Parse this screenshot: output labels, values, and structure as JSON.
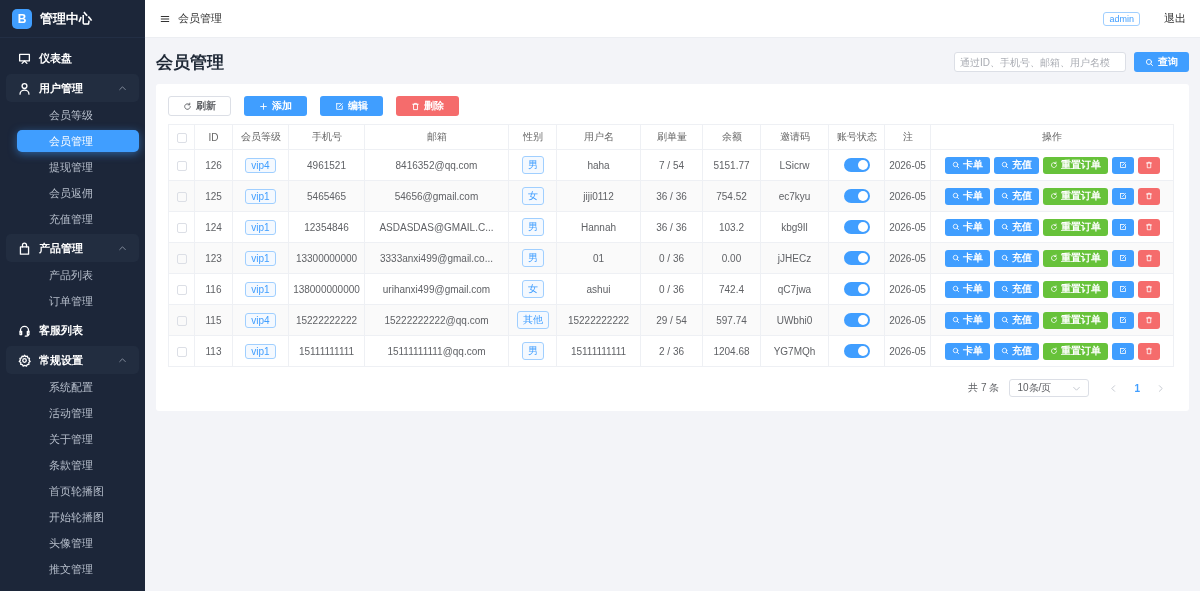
{
  "sidebar": {
    "brand": {
      "logo": "B",
      "title": "管理中心"
    },
    "items": [
      {
        "kind": "link",
        "label": "仪表盘"
      },
      {
        "kind": "group",
        "label": "用户管理",
        "expanded": true,
        "children": [
          {
            "label": "会员等级",
            "selected": false
          },
          {
            "label": "会员管理",
            "selected": true
          },
          {
            "label": "提现管理",
            "selected": false
          },
          {
            "label": "会员返佣",
            "selected": false
          },
          {
            "label": "充值管理",
            "selected": false
          }
        ]
      },
      {
        "kind": "group",
        "label": "产品管理",
        "expanded": true,
        "children": [
          {
            "label": "产品列表",
            "selected": false
          },
          {
            "label": "订单管理",
            "selected": false
          }
        ]
      },
      {
        "kind": "link",
        "label": "客服列表"
      },
      {
        "kind": "group",
        "label": "常规设置",
        "expanded": true,
        "children": [
          {
            "label": "系统配置",
            "selected": false
          },
          {
            "label": "活动管理",
            "selected": false
          },
          {
            "label": "关于管理",
            "selected": false
          },
          {
            "label": "条款管理",
            "selected": false
          },
          {
            "label": "首页轮播图",
            "selected": false
          },
          {
            "label": "开始轮播图",
            "selected": false
          },
          {
            "label": "头像管理",
            "selected": false
          },
          {
            "label": "推文管理",
            "selected": false
          }
        ]
      }
    ]
  },
  "topbar": {
    "breadcrumb": "会员管理",
    "user": "admin",
    "logout": "退出"
  },
  "page": {
    "title": "会员管理",
    "search": {
      "placeholder": "通过ID、手机号、邮箱、用户名模"
    },
    "search_button": "查询"
  },
  "toolbar": [
    {
      "label": "刷新"
    },
    {
      "label": "添加"
    },
    {
      "label": "编辑"
    },
    {
      "label": "删除"
    }
  ],
  "table": {
    "select_all": {
      "checked": false
    },
    "columns": [
      "ID",
      "会员等级",
      "手机号",
      "邮箱",
      "性别",
      "用户名",
      "刷单量",
      "余额",
      "邀请码",
      "账号状态",
      "注",
      "操作"
    ],
    "rows": [
      {
        "checked": false,
        "id": "126",
        "level": "vip4",
        "phone": "4961521",
        "email": "8416352@qq.com",
        "gender": "男",
        "username": "haha",
        "orders": "7 / 54",
        "balance": "5151.77",
        "invite": "LSicrw",
        "active": true,
        "column_11": "2026-05",
        "actions": [
          "卡单",
          "充值",
          "重置订单"
        ]
      },
      {
        "checked": false,
        "id": "125",
        "level": "vip1",
        "phone": "5465465",
        "email": "54656@gmail.com",
        "gender": "女",
        "username": "jiji0112",
        "orders": "36 / 36",
        "balance": "754.52",
        "invite": "ec7kyu",
        "active": true,
        "column_11": "2026-05",
        "actions": [
          "卡单",
          "充值",
          "重置订单"
        ]
      },
      {
        "checked": false,
        "id": "124",
        "level": "vip1",
        "phone": "12354846",
        "email": "ASDASDAS@GMAIL.C...",
        "gender": "男",
        "username": "Hannah",
        "orders": "36 / 36",
        "balance": "103.2",
        "invite": "kbg9Il",
        "active": true,
        "column_11": "2026-05",
        "actions": [
          "卡单",
          "充值",
          "重置订单"
        ]
      },
      {
        "checked": false,
        "id": "123",
        "level": "vip1",
        "phone": "13300000000",
        "email": "3333anxi499@gmail.co...",
        "gender": "男",
        "username": "01",
        "orders": "0 / 36",
        "balance": "0.00",
        "invite": "jJHECz",
        "active": true,
        "column_11": "2026-05",
        "actions": [
          "卡单",
          "充值",
          "重置订单"
        ]
      },
      {
        "checked": false,
        "id": "116",
        "level": "vip1",
        "phone": "138000000000",
        "email": "urihanxi499@gmail.com",
        "gender": "女",
        "username": "ashui",
        "orders": "0 / 36",
        "balance": "742.4",
        "invite": "qC7jwa",
        "active": true,
        "column_11": "2026-05",
        "actions": [
          "卡单",
          "充值",
          "重置订单"
        ]
      },
      {
        "checked": false,
        "id": "115",
        "level": "vip4",
        "phone": "15222222222",
        "email": "15222222222@qq.com",
        "gender": "其他",
        "username": "15222222222",
        "orders": "29 / 54",
        "balance": "597.74",
        "invite": "UWbhi0",
        "active": true,
        "column_11": "2026-05",
        "actions": [
          "卡单",
          "充值",
          "重置订单"
        ]
      },
      {
        "checked": false,
        "id": "113",
        "level": "vip1",
        "phone": "15111111111",
        "email": "15111111111@qq.com",
        "gender": "男",
        "username": "15111111111",
        "orders": "2 / 36",
        "balance": "1204.68",
        "invite": "YG7MQh",
        "active": true,
        "column_11": "2026-05",
        "actions": [
          "卡单",
          "充值",
          "重置订单"
        ]
      }
    ]
  },
  "pagination": {
    "total": "共 7 条",
    "page_size": "10条/页",
    "pages": [
      {
        "label": "1",
        "selected": true
      }
    ]
  }
}
